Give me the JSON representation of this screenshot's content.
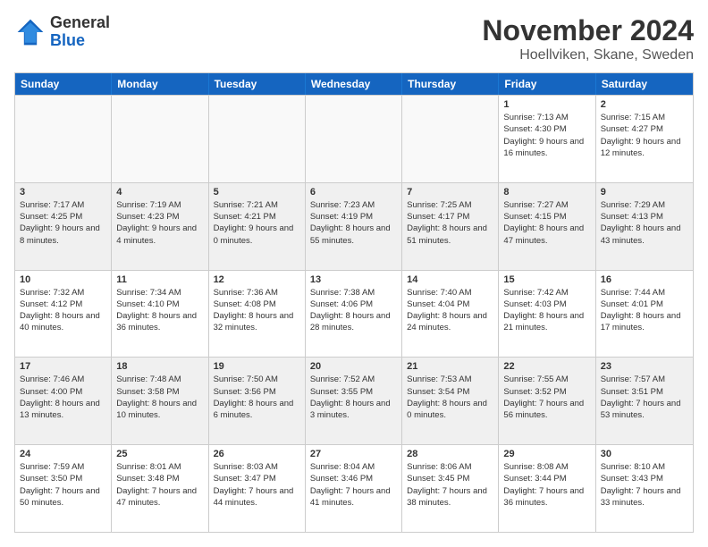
{
  "logo": {
    "line1": "General",
    "line2": "Blue"
  },
  "header": {
    "title": "November 2024",
    "location": "Hoellviken, Skane, Sweden"
  },
  "weekdays": [
    "Sunday",
    "Monday",
    "Tuesday",
    "Wednesday",
    "Thursday",
    "Friday",
    "Saturday"
  ],
  "rows": [
    [
      {
        "day": "",
        "info": ""
      },
      {
        "day": "",
        "info": ""
      },
      {
        "day": "",
        "info": ""
      },
      {
        "day": "",
        "info": ""
      },
      {
        "day": "",
        "info": ""
      },
      {
        "day": "1",
        "info": "Sunrise: 7:13 AM\nSunset: 4:30 PM\nDaylight: 9 hours and 16 minutes."
      },
      {
        "day": "2",
        "info": "Sunrise: 7:15 AM\nSunset: 4:27 PM\nDaylight: 9 hours and 12 minutes."
      }
    ],
    [
      {
        "day": "3",
        "info": "Sunrise: 7:17 AM\nSunset: 4:25 PM\nDaylight: 9 hours and 8 minutes."
      },
      {
        "day": "4",
        "info": "Sunrise: 7:19 AM\nSunset: 4:23 PM\nDaylight: 9 hours and 4 minutes."
      },
      {
        "day": "5",
        "info": "Sunrise: 7:21 AM\nSunset: 4:21 PM\nDaylight: 9 hours and 0 minutes."
      },
      {
        "day": "6",
        "info": "Sunrise: 7:23 AM\nSunset: 4:19 PM\nDaylight: 8 hours and 55 minutes."
      },
      {
        "day": "7",
        "info": "Sunrise: 7:25 AM\nSunset: 4:17 PM\nDaylight: 8 hours and 51 minutes."
      },
      {
        "day": "8",
        "info": "Sunrise: 7:27 AM\nSunset: 4:15 PM\nDaylight: 8 hours and 47 minutes."
      },
      {
        "day": "9",
        "info": "Sunrise: 7:29 AM\nSunset: 4:13 PM\nDaylight: 8 hours and 43 minutes."
      }
    ],
    [
      {
        "day": "10",
        "info": "Sunrise: 7:32 AM\nSunset: 4:12 PM\nDaylight: 8 hours and 40 minutes."
      },
      {
        "day": "11",
        "info": "Sunrise: 7:34 AM\nSunset: 4:10 PM\nDaylight: 8 hours and 36 minutes."
      },
      {
        "day": "12",
        "info": "Sunrise: 7:36 AM\nSunset: 4:08 PM\nDaylight: 8 hours and 32 minutes."
      },
      {
        "day": "13",
        "info": "Sunrise: 7:38 AM\nSunset: 4:06 PM\nDaylight: 8 hours and 28 minutes."
      },
      {
        "day": "14",
        "info": "Sunrise: 7:40 AM\nSunset: 4:04 PM\nDaylight: 8 hours and 24 minutes."
      },
      {
        "day": "15",
        "info": "Sunrise: 7:42 AM\nSunset: 4:03 PM\nDaylight: 8 hours and 21 minutes."
      },
      {
        "day": "16",
        "info": "Sunrise: 7:44 AM\nSunset: 4:01 PM\nDaylight: 8 hours and 17 minutes."
      }
    ],
    [
      {
        "day": "17",
        "info": "Sunrise: 7:46 AM\nSunset: 4:00 PM\nDaylight: 8 hours and 13 minutes."
      },
      {
        "day": "18",
        "info": "Sunrise: 7:48 AM\nSunset: 3:58 PM\nDaylight: 8 hours and 10 minutes."
      },
      {
        "day": "19",
        "info": "Sunrise: 7:50 AM\nSunset: 3:56 PM\nDaylight: 8 hours and 6 minutes."
      },
      {
        "day": "20",
        "info": "Sunrise: 7:52 AM\nSunset: 3:55 PM\nDaylight: 8 hours and 3 minutes."
      },
      {
        "day": "21",
        "info": "Sunrise: 7:53 AM\nSunset: 3:54 PM\nDaylight: 8 hours and 0 minutes."
      },
      {
        "day": "22",
        "info": "Sunrise: 7:55 AM\nSunset: 3:52 PM\nDaylight: 7 hours and 56 minutes."
      },
      {
        "day": "23",
        "info": "Sunrise: 7:57 AM\nSunset: 3:51 PM\nDaylight: 7 hours and 53 minutes."
      }
    ],
    [
      {
        "day": "24",
        "info": "Sunrise: 7:59 AM\nSunset: 3:50 PM\nDaylight: 7 hours and 50 minutes."
      },
      {
        "day": "25",
        "info": "Sunrise: 8:01 AM\nSunset: 3:48 PM\nDaylight: 7 hours and 47 minutes."
      },
      {
        "day": "26",
        "info": "Sunrise: 8:03 AM\nSunset: 3:47 PM\nDaylight: 7 hours and 44 minutes."
      },
      {
        "day": "27",
        "info": "Sunrise: 8:04 AM\nSunset: 3:46 PM\nDaylight: 7 hours and 41 minutes."
      },
      {
        "day": "28",
        "info": "Sunrise: 8:06 AM\nSunset: 3:45 PM\nDaylight: 7 hours and 38 minutes."
      },
      {
        "day": "29",
        "info": "Sunrise: 8:08 AM\nSunset: 3:44 PM\nDaylight: 7 hours and 36 minutes."
      },
      {
        "day": "30",
        "info": "Sunrise: 8:10 AM\nSunset: 3:43 PM\nDaylight: 7 hours and 33 minutes."
      }
    ]
  ]
}
